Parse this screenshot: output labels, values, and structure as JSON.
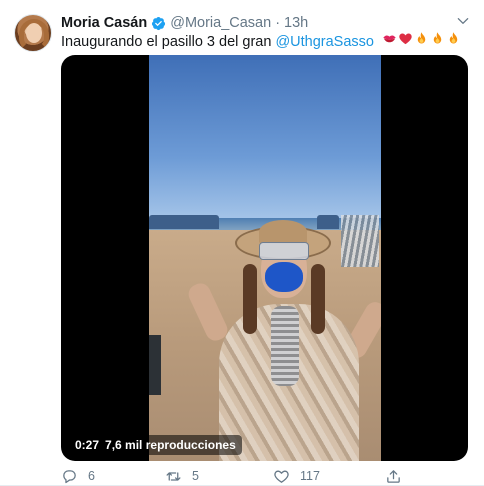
{
  "tweet": {
    "author_name": "Moria Casán",
    "author_handle": "@Moria_Casan",
    "separator": "·",
    "time": "13h",
    "text_before": "Inaugurando el pasillo 3 del gran ",
    "mention": "@UthgraSasso",
    "emojis": [
      "kiss-mark-icon",
      "red-heart-icon",
      "fire-icon",
      "fire-icon",
      "fire-icon"
    ]
  },
  "media": {
    "duration": "0:27",
    "views": "7,6 mil reproducciones"
  },
  "actions": {
    "replies": "6",
    "retweets": "5",
    "likes": "117"
  },
  "colors": {
    "link": "#1b95e0",
    "verified": "#1da1f2",
    "secondary_text": "#657786"
  }
}
